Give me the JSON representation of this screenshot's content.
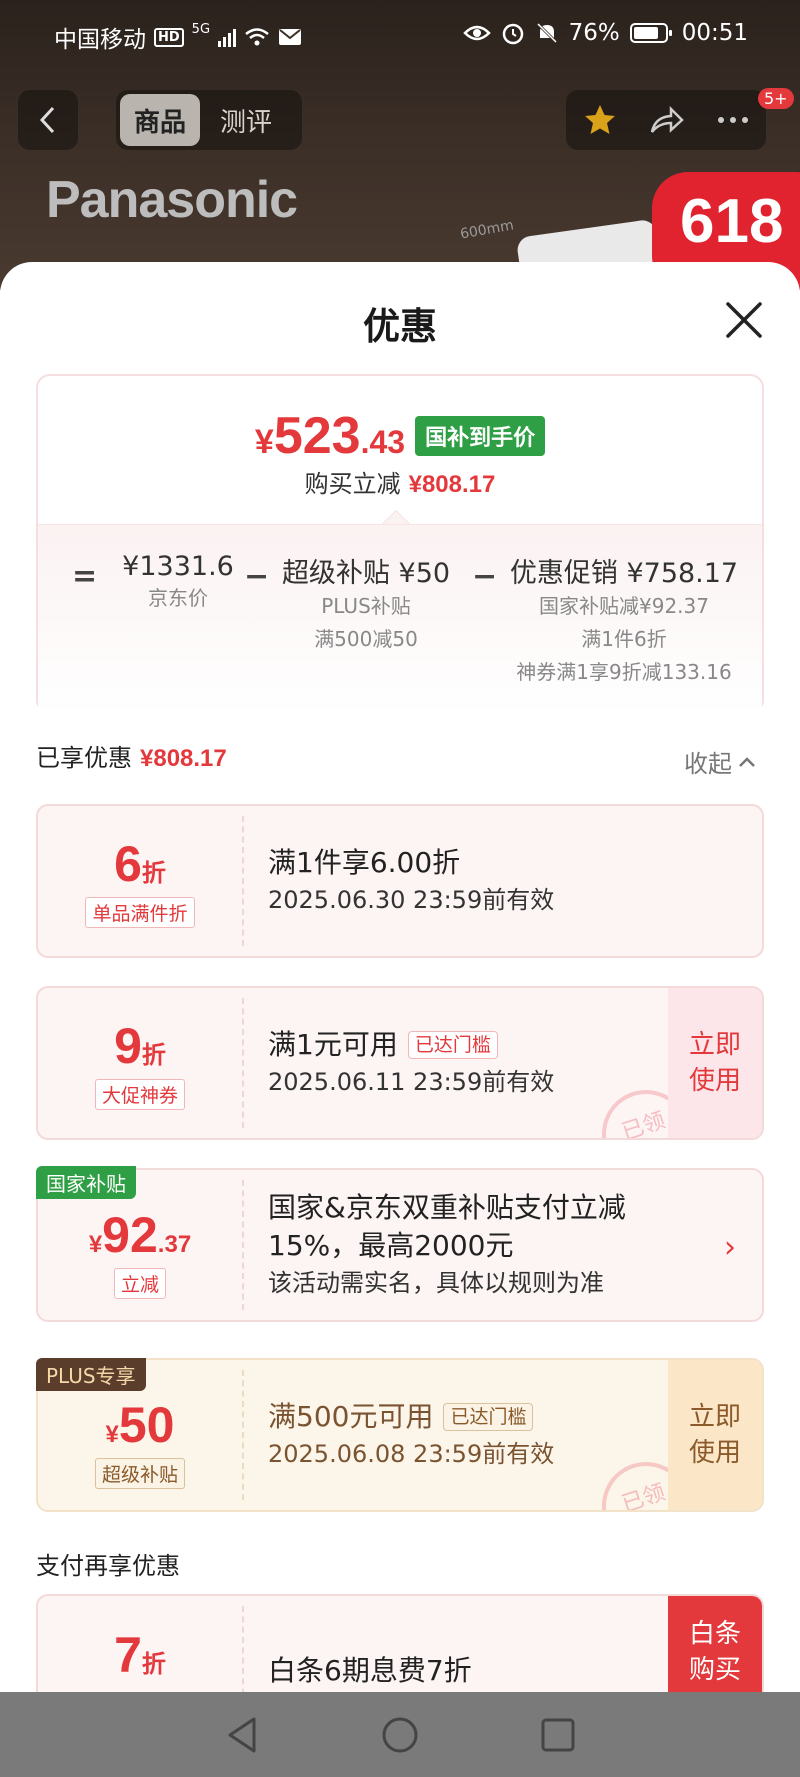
{
  "status_bar": {
    "carrier": "中国移动",
    "hd": "HD",
    "net": "5G",
    "battery": "76%",
    "time": "00:51"
  },
  "header": {
    "tabs": [
      {
        "label": "商品",
        "active": true
      },
      {
        "label": "测评",
        "active": false
      }
    ],
    "cart_badge": "5+"
  },
  "backdrop": {
    "brand": "Panasonic",
    "dimension": "600mm",
    "promo": "618"
  },
  "sheet": {
    "title": "优惠",
    "summary": {
      "currency": "¥",
      "price_int": "523",
      "price_dec": ".43",
      "price_tag": "国补到手价",
      "save_label": "购买立减",
      "save_value": "¥808.17",
      "breakdown": {
        "eq": "=",
        "minus": "−",
        "jd_price": "¥1331.6",
        "jd_label": "京东价",
        "super_value": "超级补贴 ¥50",
        "super_notes": [
          "PLUS补贴",
          "满500减50"
        ],
        "promo_value": "优惠促销 ¥758.17",
        "promo_notes": [
          "国家补贴减¥92.37",
          "满1件6折",
          "神券满1享9折减133.16"
        ]
      }
    },
    "enjoyed_label": "已享优惠",
    "enjoyed_value": "¥808.17",
    "collapse_label": "收起",
    "cards": [
      {
        "disc_big": "6",
        "disc_small": "折",
        "tag": "单品满件折",
        "title": "满1件享6.00折",
        "date": "2025.06.30 23:59前有效"
      },
      {
        "disc_big": "9",
        "disc_small": "折",
        "tag": "大促神券",
        "title": "满1元可用",
        "reached": "已达门槛",
        "date": "2025.06.11 23:59前有效",
        "button": "立即使用",
        "stamp": "已领"
      },
      {
        "corner": "国家补贴",
        "disc_cur": "¥",
        "disc_big": "92",
        "disc_small": ".37",
        "tag": "立减",
        "title": "国家&京东双重补贴支付立减15%，最高2000元",
        "date": "该活动需实名，具体以规则为准",
        "arrow": "›"
      },
      {
        "corner": "PLUS专享",
        "disc_cur": "¥",
        "disc_big": "50",
        "tag": "超级补贴",
        "title": "满500元可用",
        "reached": "已达门槛",
        "date": "2025.06.08 23:59前有效",
        "button": "立即使用",
        "stamp": "已领"
      },
      {
        "disc_big": "7",
        "disc_small": "折",
        "title": "白条6期息费7折",
        "button": "白条购买"
      }
    ],
    "section2": "支付再享优惠"
  }
}
